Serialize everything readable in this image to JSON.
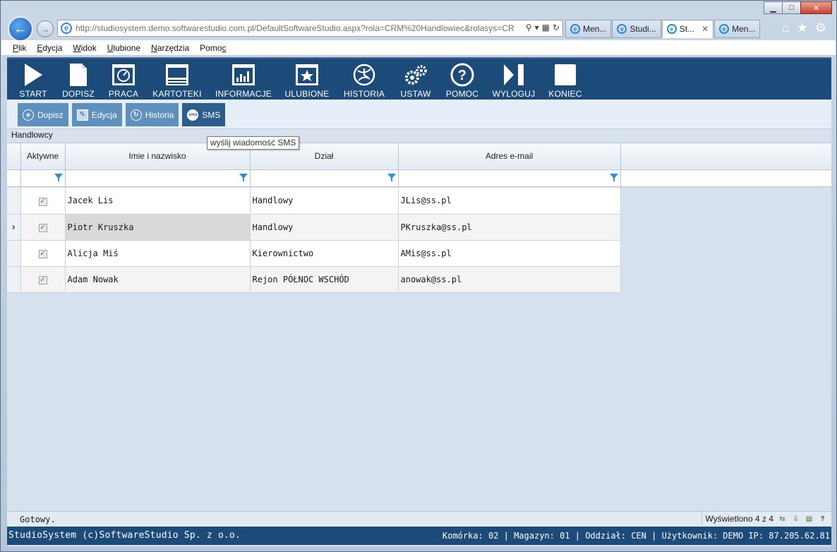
{
  "window": {
    "buttons": {
      "minimize": "▁",
      "maximize": "□",
      "close": "✕"
    }
  },
  "browser": {
    "url": "http://studiosystem.demo.softwarestudio.com.pl/DefaultSoftwareStudio.aspx?rola=CRM%20Handlowiec&rolasys=CR",
    "tabs": [
      {
        "title": "Men...",
        "active": false
      },
      {
        "title": "Studi...",
        "active": false
      },
      {
        "title": "St...",
        "active": true
      },
      {
        "title": "Men...",
        "active": false
      }
    ],
    "icons": [
      "back-arrow-icon",
      "forward-arrow-icon",
      "home-icon",
      "favorites-star-icon",
      "settings-gear-icon"
    ]
  },
  "menu": {
    "items": [
      {
        "label": "Plik",
        "underline": "P"
      },
      {
        "label": "Edycja",
        "underline": "E"
      },
      {
        "label": "Widok",
        "underline": "W"
      },
      {
        "label": "Ulubione",
        "underline": "U"
      },
      {
        "label": "Narzędzia",
        "underline": "N"
      },
      {
        "label": "Pomoc",
        "underline": "c"
      }
    ]
  },
  "toolbar": {
    "buttons": [
      {
        "label": "START",
        "icon": "play-icon"
      },
      {
        "label": "DOPISZ",
        "icon": "document-icon"
      },
      {
        "label": "PRACA",
        "icon": "gauge-window-icon"
      },
      {
        "label": "KARTOTEKI",
        "icon": "window-list-icon"
      },
      {
        "label": "INFORMACJE",
        "icon": "bar-chart-icon"
      },
      {
        "label": "ULUBIONE",
        "icon": "star-window-icon"
      },
      {
        "label": "HISTORIA",
        "icon": "history-globe-icon"
      },
      {
        "label": "USTAW",
        "icon": "gears-icon"
      },
      {
        "label": "POMOC",
        "icon": "help-icon"
      },
      {
        "label": "WYLOGUJ",
        "icon": "logout-icon"
      },
      {
        "label": "KONIEC",
        "icon": "stop-square-icon"
      }
    ]
  },
  "subtoolbar": {
    "buttons": [
      {
        "label": "Dopisz",
        "icon": "plus-circle-icon"
      },
      {
        "label": "Edycja",
        "icon": "edit-icon"
      },
      {
        "label": "Historia",
        "icon": "history-icon"
      },
      {
        "label": "SMS",
        "icon": "sms-icon"
      }
    ],
    "tooltip": "wyślij wiadomość SMS"
  },
  "grid": {
    "title": "Handlowcy",
    "columns": [
      "Aktywne",
      "Imie i nazwisko",
      "Dział",
      "Adres e-mail"
    ],
    "rows": [
      {
        "active": true,
        "name": "Jacek Lis",
        "dept": "Handlowy",
        "email": "JLis@ss.pl",
        "current": false
      },
      {
        "active": true,
        "name": "Piotr Kruszka",
        "dept": "Handlowy",
        "email": "PKruszka@ss.pl",
        "current": true
      },
      {
        "active": true,
        "name": "Alicja Miś",
        "dept": "Kierownictwo",
        "email": "AMis@ss.pl",
        "current": false
      },
      {
        "active": true,
        "name": "Adam Nowak",
        "dept": "Rejon PÓŁNOC WSCHÓD",
        "email": "anowak@ss.pl",
        "current": false
      }
    ],
    "current_marker": "›"
  },
  "status": {
    "left": "Gotowy.",
    "count": "Wyświetlono 4 z 4"
  },
  "footer": {
    "left": "StudioSystem (c)SoftwareStudio Sp. z o.o.",
    "right": "Komórka: 02 | Magazyn: 01 | Oddział: CEN | Użytkownik: DEMO IP: 87.205.62.81"
  }
}
